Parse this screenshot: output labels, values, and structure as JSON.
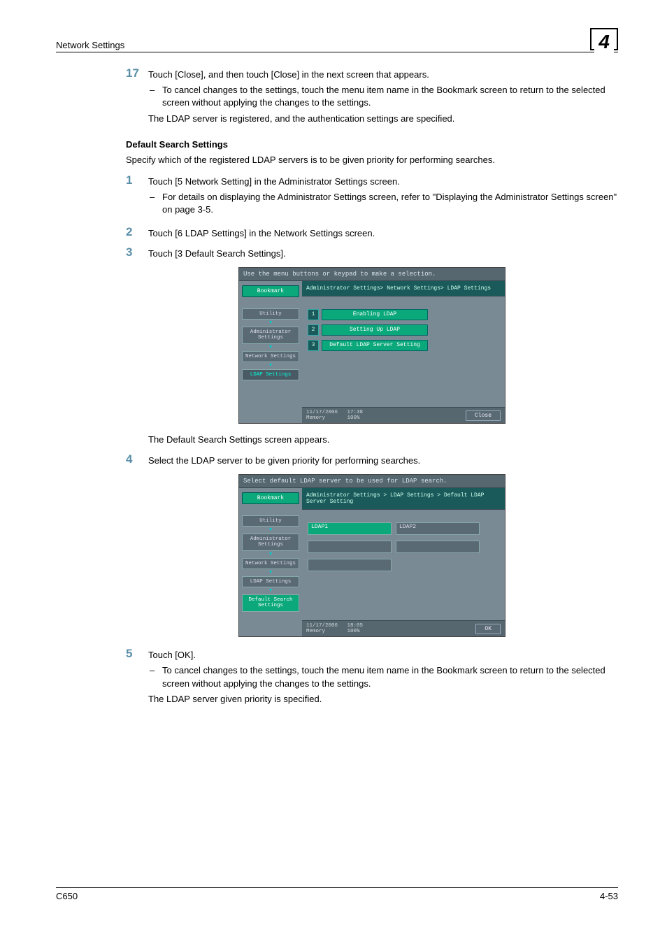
{
  "header": {
    "section": "Network Settings",
    "chapter": "4"
  },
  "step17": {
    "num": "17",
    "text": "Touch [Close], and then touch [Close] in the next screen that appears.",
    "bullet": "To cancel changes to the settings, touch the menu item name in the Bookmark screen to return to the selected screen without applying the changes to the settings.",
    "after": "The LDAP server is registered, and the authentication settings are specified."
  },
  "section": {
    "heading": "Default Search Settings",
    "intro": "Specify which of the registered LDAP servers is to be given priority for performing searches."
  },
  "steps": [
    {
      "num": "1",
      "text": "Touch [5 Network Setting] in the Administrator Settings screen.",
      "bullet": "For details on displaying the Administrator Settings screen, refer to \"Displaying the Administrator Settings screen\" on page 3-5."
    },
    {
      "num": "2",
      "text": "Touch [6 LDAP Settings] in the Network Settings screen."
    },
    {
      "num": "3",
      "text": "Touch [3 Default Search Settings]."
    }
  ],
  "mock1": {
    "top": "Use the menu buttons or keypad to make a selection.",
    "crumb": "Administrator Settings> Network Settings> LDAP Settings",
    "bookmark": "Bookmark",
    "side": [
      "Utility",
      "Administrator Settings",
      "Network Settings",
      "LDAP Settings"
    ],
    "items": [
      {
        "n": "1",
        "label": "Enabling LDAP"
      },
      {
        "n": "2",
        "label": "Setting Up LDAP"
      },
      {
        "n": "3",
        "label": "Default LDAP Server Setting"
      }
    ],
    "status_date": "11/17/2006",
    "status_time": "17:38",
    "status_mem": "Memory",
    "status_pct": "100%",
    "close": "Close"
  },
  "between3_4": "The Default Search Settings screen appears.",
  "step4": {
    "num": "4",
    "text": "Select the LDAP server to be given priority for performing searches."
  },
  "mock2": {
    "top": "Select default LDAP server to be used for LDAP search.",
    "crumb": "Administrator Settings > LDAP Settings > Default LDAP Server Setting",
    "bookmark": "Bookmark",
    "side": [
      "Utility",
      "Administrator Settings",
      "Network Settings",
      "LDAP Settings",
      "Default Search Settings"
    ],
    "servers": [
      "LDAP1",
      "LDAP2"
    ],
    "status_date": "11/17/2006",
    "status_time": "18:05",
    "status_mem": "Memory",
    "status_pct": "100%",
    "ok": "OK"
  },
  "step5": {
    "num": "5",
    "text": "Touch [OK].",
    "bullet": "To cancel changes to the settings, touch the menu item name in the Bookmark screen to return to the selected screen without applying the changes to the settings.",
    "after": "The LDAP server given priority is specified."
  },
  "footer": {
    "left": "C650",
    "right": "4-53"
  }
}
